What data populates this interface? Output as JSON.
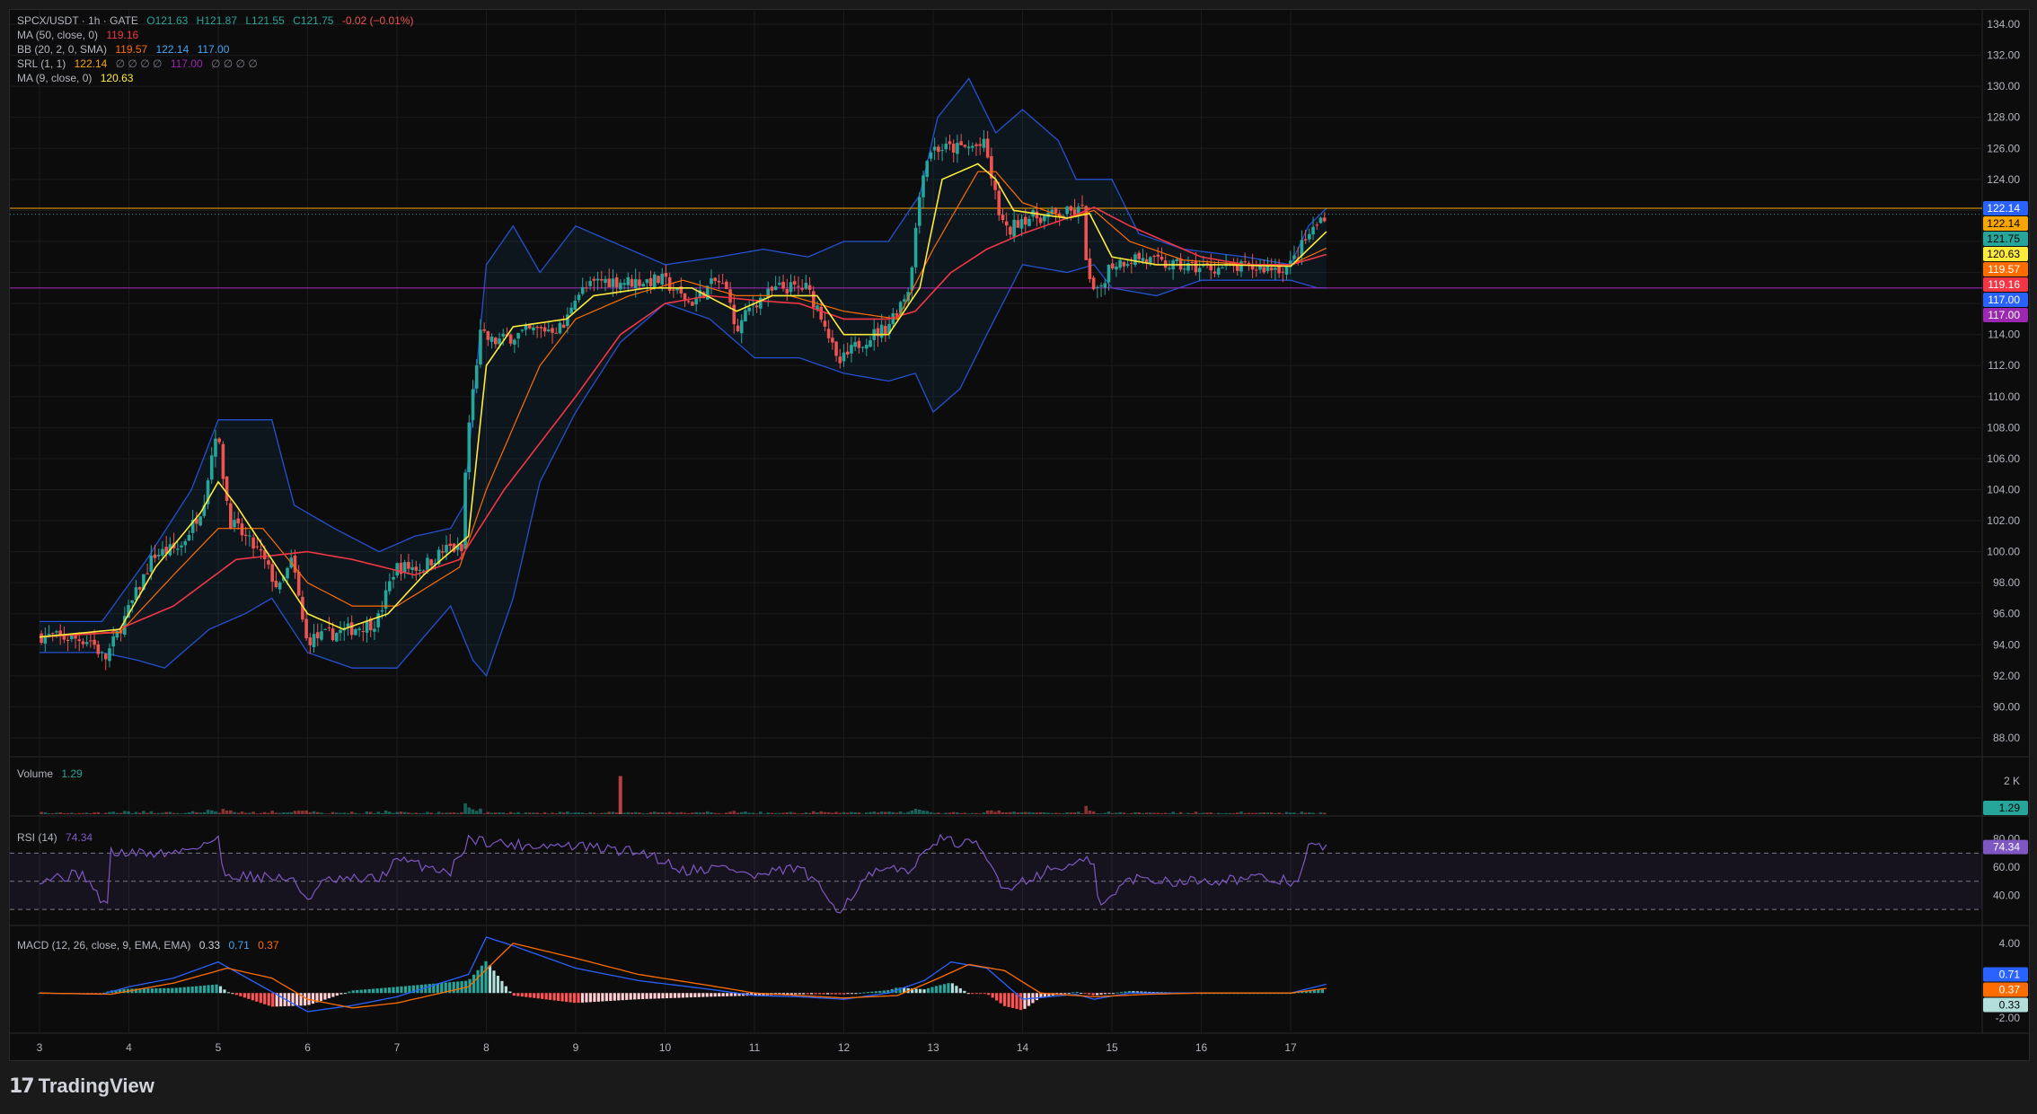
{
  "legend": {
    "symbol": "SPCX/USDT · 1h · GATE",
    "ohlc": {
      "o": "O121.63",
      "h": "H121.87",
      "l": "L121.55",
      "c": "C121.75",
      "chg": "-0.02 (−0.01%)"
    },
    "ma50": {
      "label": "MA (50, close, 0)",
      "value": "119.16"
    },
    "bb": {
      "label": "BB (20, 2, 0, SMA)",
      "basis": "119.57",
      "upper": "122.14",
      "lower": "117.00"
    },
    "srl": {
      "label": "SRL (1, 1)",
      "a": "122.14",
      "zeros1": "∅ ∅ ∅ ∅",
      "b": "117.00",
      "zeros2": "∅ ∅ ∅ ∅"
    },
    "ma9": {
      "label": "MA (9, close, 0)",
      "value": "120.63"
    }
  },
  "panes": {
    "volume": {
      "label": "Volume",
      "value": "1.29",
      "axis": [
        "2 K"
      ]
    },
    "rsi": {
      "label": "RSI (14)",
      "value": "74.34",
      "axis": [
        "80.00",
        "60.00",
        "40.00"
      ]
    },
    "macd": {
      "label": "MACD (12, 26, close, 9, EMA, EMA)",
      "hist": "0.33",
      "macd": "0.71",
      "signal": "0.37",
      "axis": [
        "4.00",
        "-2.00"
      ]
    }
  },
  "footer": {
    "brand": "TradingView",
    "logo_glyph": "17"
  },
  "colors": {
    "up": "#26a69a",
    "down": "#ef5350",
    "ma9": "#ffeb3b",
    "ma50": "#f23645",
    "bb_upper": "#2962ff",
    "bb_basis": "#ff6d00",
    "bb_band": "#2196f3",
    "srl_high": "#f7a600",
    "srl_low": "#9c27b0",
    "rsi": "#7e57c2",
    "macd_line": "#2962ff",
    "macd_signal": "#ff6d00"
  },
  "chart_data": {
    "type": "candlestick",
    "x_axis_labels": [
      "3",
      "4",
      "5",
      "6",
      "7",
      "8",
      "9",
      "10",
      "11",
      "12",
      "13",
      "14",
      "15",
      "16",
      "17"
    ],
    "price_axis_labels": [
      "134.00",
      "132.00",
      "130.00",
      "128.00",
      "126.00",
      "124.00",
      "122.00",
      "120.00",
      "118.00",
      "116.00",
      "114.00",
      "112.00",
      "110.00",
      "108.00",
      "106.00",
      "104.00",
      "102.00",
      "100.00",
      "98.00",
      "96.00",
      "94.00",
      "92.00",
      "90.00",
      "88.00"
    ],
    "ylim": [
      87,
      135
    ],
    "price_tags": [
      {
        "value": 122.14,
        "text": "122.14",
        "color": "#2962ff"
      },
      {
        "value": 122.14,
        "text": "122.14",
        "color": "#f7a600"
      },
      {
        "value": 121.75,
        "text": "121.75",
        "color": "#26a69a"
      },
      {
        "value": 120.63,
        "text": "120.63",
        "color": "#ffeb3b"
      },
      {
        "value": 119.57,
        "text": "119.57",
        "color": "#ff6d00"
      },
      {
        "value": 119.16,
        "text": "119.16",
        "color": "#f23645"
      },
      {
        "value": 117.0,
        "text": "117.00",
        "color": "#2962ff"
      },
      {
        "value": 117.0,
        "text": "117.00",
        "color": "#9c27b0"
      }
    ],
    "srl_levels": [
      122.14,
      117.0
    ],
    "last_close": 121.75,
    "price_path": [
      [
        3.0,
        94.6
      ],
      [
        3.6,
        94.3
      ],
      [
        3.75,
        93.0
      ],
      [
        4.0,
        96.0
      ],
      [
        4.3,
        99.8
      ],
      [
        4.6,
        100.3
      ],
      [
        4.85,
        103.0
      ],
      [
        5.0,
        108.0
      ],
      [
        5.15,
        102.0
      ],
      [
        5.5,
        99.8
      ],
      [
        5.7,
        97.5
      ],
      [
        5.85,
        99.5
      ],
      [
        6.0,
        94.3
      ],
      [
        6.5,
        95.0
      ],
      [
        6.8,
        95.5
      ],
      [
        7.0,
        99.0
      ],
      [
        7.3,
        99.0
      ],
      [
        7.6,
        100.3
      ],
      [
        7.75,
        100.0
      ],
      [
        7.8,
        107.0
      ],
      [
        7.95,
        114.0
      ],
      [
        8.1,
        113.5
      ],
      [
        8.5,
        114.2
      ],
      [
        8.9,
        114.5
      ],
      [
        9.0,
        116.5
      ],
      [
        9.3,
        117.5
      ],
      [
        9.6,
        117.4
      ],
      [
        10.0,
        117.5
      ],
      [
        10.3,
        116.0
      ],
      [
        10.6,
        117.5
      ],
      [
        10.75,
        116.5
      ],
      [
        10.8,
        114.0
      ],
      [
        11.0,
        116.0
      ],
      [
        11.3,
        117.0
      ],
      [
        11.6,
        117.0
      ],
      [
        11.8,
        115.0
      ],
      [
        11.95,
        112.0
      ],
      [
        12.2,
        113.5
      ],
      [
        12.5,
        114.5
      ],
      [
        12.75,
        117.0
      ],
      [
        12.9,
        124.5
      ],
      [
        13.0,
        126.0
      ],
      [
        13.3,
        126.0
      ],
      [
        13.6,
        126.2
      ],
      [
        13.75,
        122.0
      ],
      [
        13.85,
        120.5
      ],
      [
        14.0,
        121.5
      ],
      [
        14.4,
        121.7
      ],
      [
        14.7,
        122.0
      ],
      [
        14.75,
        117.5
      ],
      [
        14.85,
        116.5
      ],
      [
        15.0,
        118.5
      ],
      [
        15.3,
        119.0
      ],
      [
        15.6,
        118.5
      ],
      [
        16.0,
        118.3
      ],
      [
        16.5,
        118.3
      ],
      [
        17.0,
        118.3
      ],
      [
        17.2,
        120.2
      ],
      [
        17.4,
        121.75
      ]
    ],
    "ma50_path": [
      [
        3.0,
        94.5
      ],
      [
        3.8,
        94.8
      ],
      [
        4.5,
        96.5
      ],
      [
        5.2,
        99.5
      ],
      [
        6.0,
        100.0
      ],
      [
        6.5,
        99.5
      ],
      [
        7.2,
        98.5
      ],
      [
        7.7,
        99.5
      ],
      [
        8.2,
        104.0
      ],
      [
        9.0,
        110.0
      ],
      [
        9.5,
        114.0
      ],
      [
        10.0,
        116.0
      ],
      [
        10.5,
        116.5
      ],
      [
        11.0,
        116.2
      ],
      [
        11.5,
        116.0
      ],
      [
        12.0,
        115.0
      ],
      [
        12.5,
        115.0
      ],
      [
        12.8,
        115.5
      ],
      [
        13.2,
        118.0
      ],
      [
        13.6,
        119.5
      ],
      [
        14.0,
        120.5
      ],
      [
        14.5,
        121.5
      ],
      [
        14.8,
        122.2
      ],
      [
        15.2,
        121.0
      ],
      [
        15.6,
        120.0
      ],
      [
        16.0,
        119.0
      ],
      [
        16.5,
        118.5
      ],
      [
        17.0,
        118.5
      ],
      [
        17.4,
        119.16
      ]
    ],
    "ma9_path": [
      [
        3.0,
        94.5
      ],
      [
        3.9,
        95.0
      ],
      [
        4.3,
        99.0
      ],
      [
        4.8,
        102.5
      ],
      [
        5.0,
        104.5
      ],
      [
        5.2,
        103.0
      ],
      [
        5.6,
        99.5
      ],
      [
        6.0,
        96.0
      ],
      [
        6.4,
        95.0
      ],
      [
        6.9,
        96.0
      ],
      [
        7.3,
        98.5
      ],
      [
        7.8,
        101.0
      ],
      [
        8.0,
        112.0
      ],
      [
        8.3,
        114.5
      ],
      [
        8.9,
        115.0
      ],
      [
        9.2,
        116.5
      ],
      [
        9.8,
        117.0
      ],
      [
        10.3,
        117.0
      ],
      [
        10.8,
        115.5
      ],
      [
        11.2,
        116.5
      ],
      [
        11.7,
        116.5
      ],
      [
        12.0,
        114.0
      ],
      [
        12.5,
        114.0
      ],
      [
        12.85,
        117.0
      ],
      [
        13.1,
        124.0
      ],
      [
        13.5,
        125.0
      ],
      [
        13.7,
        124.0
      ],
      [
        13.9,
        122.0
      ],
      [
        14.5,
        121.5
      ],
      [
        14.75,
        121.8
      ],
      [
        15.0,
        119.0
      ],
      [
        15.5,
        118.5
      ],
      [
        16.2,
        118.5
      ],
      [
        17.0,
        118.4
      ],
      [
        17.4,
        120.63
      ]
    ],
    "bb_upper_path": [
      [
        3.0,
        95.5
      ],
      [
        3.7,
        95.5
      ],
      [
        4.2,
        99.5
      ],
      [
        4.7,
        104.0
      ],
      [
        5.0,
        108.5
      ],
      [
        5.6,
        108.5
      ],
      [
        5.85,
        103.0
      ],
      [
        6.3,
        101.5
      ],
      [
        6.8,
        100.0
      ],
      [
        7.2,
        101.0
      ],
      [
        7.6,
        101.5
      ],
      [
        7.75,
        103.0
      ],
      [
        8.0,
        118.5
      ],
      [
        8.3,
        121.0
      ],
      [
        8.6,
        118.0
      ],
      [
        9.0,
        121.0
      ],
      [
        9.6,
        119.5
      ],
      [
        10.0,
        118.5
      ],
      [
        10.6,
        119.0
      ],
      [
        11.1,
        119.5
      ],
      [
        11.6,
        119.0
      ],
      [
        12.0,
        120.0
      ],
      [
        12.5,
        120.0
      ],
      [
        12.85,
        123.0
      ],
      [
        13.05,
        128.0
      ],
      [
        13.4,
        130.5
      ],
      [
        13.7,
        127.0
      ],
      [
        14.0,
        128.5
      ],
      [
        14.4,
        126.5
      ],
      [
        14.6,
        124.0
      ],
      [
        14.75,
        124.0
      ],
      [
        15.0,
        124.0
      ],
      [
        15.3,
        120.5
      ],
      [
        15.8,
        119.5
      ],
      [
        16.5,
        119.0
      ],
      [
        17.0,
        118.5
      ],
      [
        17.2,
        121.0
      ],
      [
        17.4,
        122.14
      ]
    ],
    "bb_basis_path": [
      [
        3.0,
        94.5
      ],
      [
        3.9,
        94.8
      ],
      [
        4.5,
        98.5
      ],
      [
        5.0,
        101.5
      ],
      [
        5.5,
        101.5
      ],
      [
        6.0,
        98.0
      ],
      [
        6.5,
        96.5
      ],
      [
        7.0,
        96.5
      ],
      [
        7.7,
        99.0
      ],
      [
        8.0,
        104.0
      ],
      [
        8.6,
        112.0
      ],
      [
        9.0,
        115.0
      ],
      [
        9.6,
        116.5
      ],
      [
        10.2,
        117.5
      ],
      [
        10.8,
        116.5
      ],
      [
        11.4,
        116.5
      ],
      [
        12.0,
        115.5
      ],
      [
        12.6,
        115.0
      ],
      [
        13.0,
        119.5
      ],
      [
        13.5,
        124.5
      ],
      [
        13.7,
        124.5
      ],
      [
        14.0,
        122.5
      ],
      [
        14.5,
        121.5
      ],
      [
        14.8,
        122.0
      ],
      [
        15.2,
        120.0
      ],
      [
        15.8,
        118.8
      ],
      [
        16.5,
        118.5
      ],
      [
        17.0,
        118.5
      ],
      [
        17.4,
        119.57
      ]
    ],
    "bb_lower_path": [
      [
        3.0,
        93.5
      ],
      [
        3.7,
        93.5
      ],
      [
        4.1,
        93.0
      ],
      [
        4.4,
        92.5
      ],
      [
        4.9,
        95.0
      ],
      [
        5.3,
        96.0
      ],
      [
        5.6,
        97.0
      ],
      [
        6.0,
        93.5
      ],
      [
        6.5,
        92.5
      ],
      [
        7.0,
        92.5
      ],
      [
        7.6,
        96.5
      ],
      [
        7.85,
        93.0
      ],
      [
        8.0,
        92.0
      ],
      [
        8.3,
        97.0
      ],
      [
        8.6,
        104.5
      ],
      [
        9.0,
        109.0
      ],
      [
        9.5,
        113.5
      ],
      [
        10.0,
        116.0
      ],
      [
        10.5,
        115.0
      ],
      [
        11.0,
        112.5
      ],
      [
        11.5,
        112.5
      ],
      [
        12.0,
        111.5
      ],
      [
        12.5,
        111.0
      ],
      [
        12.8,
        111.5
      ],
      [
        13.0,
        109.0
      ],
      [
        13.3,
        110.5
      ],
      [
        13.6,
        114.0
      ],
      [
        14.0,
        118.5
      ],
      [
        14.5,
        118.0
      ],
      [
        14.8,
        118.5
      ],
      [
        15.0,
        117.0
      ],
      [
        15.5,
        116.5
      ],
      [
        16.0,
        117.5
      ],
      [
        16.5,
        117.5
      ],
      [
        17.0,
        117.5
      ],
      [
        17.3,
        117.0
      ],
      [
        17.4,
        117.0
      ]
    ],
    "volume_spike": {
      "x": 9.5,
      "value": 2300
    },
    "volume_axis_max": 2600,
    "rsi_path": [
      [
        3.0,
        52
      ],
      [
        3.5,
        55
      ],
      [
        3.75,
        30
      ],
      [
        3.8,
        70
      ],
      [
        4.5,
        70
      ],
      [
        5.0,
        80
      ],
      [
        5.05,
        55
      ],
      [
        5.8,
        52
      ],
      [
        6.0,
        38
      ],
      [
        6.2,
        50
      ],
      [
        6.8,
        52
      ],
      [
        7.0,
        65
      ],
      [
        7.6,
        57
      ],
      [
        7.8,
        80
      ],
      [
        8.3,
        76
      ],
      [
        9.0,
        75
      ],
      [
        9.8,
        70
      ],
      [
        10.2,
        58
      ],
      [
        10.7,
        60
      ],
      [
        11.0,
        53
      ],
      [
        11.5,
        60
      ],
      [
        11.95,
        30
      ],
      [
        12.3,
        55
      ],
      [
        12.8,
        60
      ],
      [
        13.0,
        80
      ],
      [
        13.5,
        75
      ],
      [
        13.8,
        45
      ],
      [
        14.3,
        58
      ],
      [
        14.8,
        65
      ],
      [
        14.85,
        30
      ],
      [
        15.2,
        52
      ],
      [
        15.8,
        50
      ],
      [
        16.5,
        52
      ],
      [
        17.1,
        50
      ],
      [
        17.2,
        75
      ],
      [
        17.4,
        74.34
      ]
    ],
    "rsi_band": [
      30,
      70
    ],
    "rsi_ylim": [
      25,
      90
    ],
    "macd_line_path": [
      [
        3.0,
        0.0
      ],
      [
        3.7,
        -0.1
      ],
      [
        4.0,
        0.5
      ],
      [
        4.5,
        1.2
      ],
      [
        5.0,
        2.5
      ],
      [
        5.5,
        0.5
      ],
      [
        6.0,
        -1.5
      ],
      [
        6.5,
        -1.0
      ],
      [
        7.0,
        -0.3
      ],
      [
        7.8,
        1.5
      ],
      [
        8.0,
        4.5
      ],
      [
        8.3,
        3.8
      ],
      [
        9.0,
        2.0
      ],
      [
        9.7,
        1.0
      ],
      [
        10.5,
        0.3
      ],
      [
        11.0,
        -0.2
      ],
      [
        11.5,
        -0.3
      ],
      [
        12.0,
        -0.5
      ],
      [
        12.5,
        0.0
      ],
      [
        12.9,
        1.0
      ],
      [
        13.2,
        2.5
      ],
      [
        13.6,
        2.0
      ],
      [
        14.0,
        -0.5
      ],
      [
        14.6,
        -0.1
      ],
      [
        14.8,
        -0.5
      ],
      [
        15.2,
        0.0
      ],
      [
        16.0,
        0.0
      ],
      [
        17.0,
        0.0
      ],
      [
        17.4,
        0.71
      ]
    ],
    "macd_signal_path": [
      [
        3.0,
        0.0
      ],
      [
        3.8,
        -0.1
      ],
      [
        4.5,
        0.8
      ],
      [
        5.1,
        2.0
      ],
      [
        5.6,
        1.2
      ],
      [
        6.0,
        -0.5
      ],
      [
        6.5,
        -1.2
      ],
      [
        7.0,
        -0.8
      ],
      [
        7.8,
        0.5
      ],
      [
        8.3,
        4.0
      ],
      [
        9.0,
        2.8
      ],
      [
        9.7,
        1.5
      ],
      [
        10.5,
        0.6
      ],
      [
        11.0,
        0.0
      ],
      [
        12.0,
        -0.4
      ],
      [
        12.6,
        -0.2
      ],
      [
        13.0,
        1.0
      ],
      [
        13.4,
        2.3
      ],
      [
        13.8,
        1.8
      ],
      [
        14.2,
        0.0
      ],
      [
        14.8,
        -0.3
      ],
      [
        15.4,
        -0.1
      ],
      [
        16.0,
        0.0
      ],
      [
        17.0,
        0.0
      ],
      [
        17.4,
        0.37
      ]
    ],
    "macd_ylim": [
      -2.8,
      5.0
    ]
  }
}
